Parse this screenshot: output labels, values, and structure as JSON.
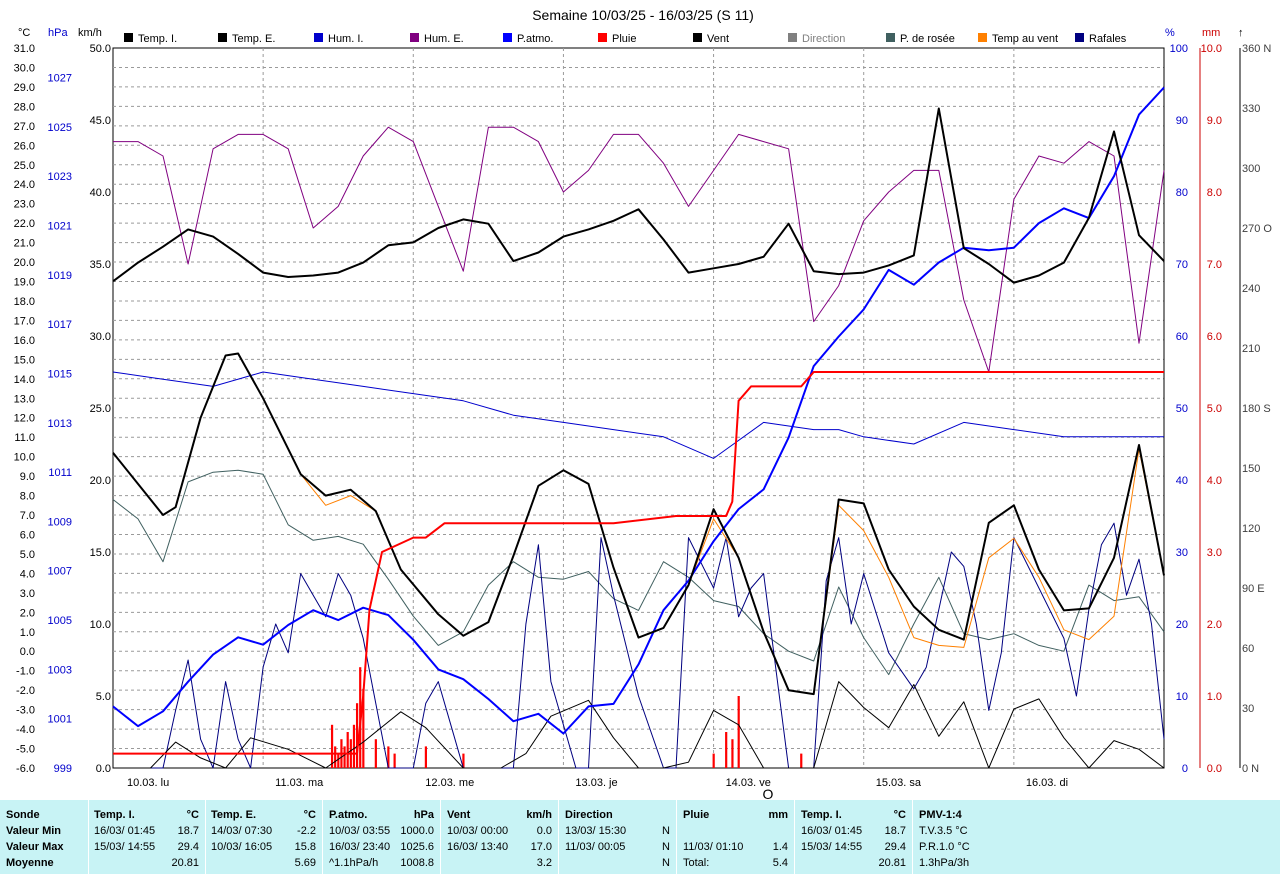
{
  "title": "Semaine 10/03/25 - 16/03/25 (S 11)",
  "axis_units": {
    "temp": "°C",
    "hpa": "hPa",
    "kmh": "km/h",
    "pct": "%",
    "mm": "mm"
  },
  "legend": [
    {
      "label": "Temp. I.",
      "color": "#000000"
    },
    {
      "label": "Temp. E.",
      "color": "#000000"
    },
    {
      "label": "Hum. I.",
      "color": "#0000cc"
    },
    {
      "label": "Hum. E.",
      "color": "#800080"
    },
    {
      "label": "P.atmo.",
      "color": "#0000ff"
    },
    {
      "label": "Pluie",
      "color": "#ff0000"
    },
    {
      "label": "Vent",
      "color": "#000000"
    },
    {
      "label": "Direction",
      "color": "#808080"
    },
    {
      "label": "P. de rosée",
      "color": "#406060"
    },
    {
      "label": "Temp au vent",
      "color": "#ff8000"
    },
    {
      "label": "Rafales",
      "color": "#000080"
    }
  ],
  "bottom_mark": "O",
  "chart_data": {
    "type": "line",
    "title": "Semaine 10/03/25 - 16/03/25 (S 11)",
    "x_days": [
      "10.03. lu",
      "11.03. ma",
      "12.03. me",
      "13.03. je",
      "14.03. ve",
      "15.03. sa",
      "16.03. di"
    ],
    "x_range_hours": [
      0,
      168
    ],
    "axes": {
      "temp_c": {
        "min": -6.0,
        "max": 31.0,
        "ticks": [
          "31.0",
          "30.0",
          "29.0",
          "28.0",
          "27.0",
          "26.0",
          "25.0",
          "24.0",
          "23.0",
          "22.0",
          "21.0",
          "20.0",
          "19.0",
          "18.0",
          "17.0",
          "16.0",
          "15.0",
          "14.0",
          "13.0",
          "12.0",
          "11.0",
          "10.0",
          "9.0",
          "8.0",
          "7.0",
          "6.0",
          "5.0",
          "4.0",
          "3.0",
          "2.0",
          "1.0",
          "0.0",
          "-1.0",
          "-2.0",
          "-3.0",
          "-4.0",
          "-5.0",
          "-6.0"
        ]
      },
      "pressure_hpa": {
        "min": 999,
        "max": 1028.2,
        "ticks": [
          "1027",
          "1025",
          "1023",
          "1021",
          "1019",
          "1017",
          "1015",
          "1013",
          "1011",
          "1009",
          "1007",
          "1005",
          "1003",
          "1001",
          "999"
        ]
      },
      "wind_kmh": {
        "min": 0,
        "max": 50,
        "ticks": [
          "50.0",
          "45.0",
          "40.0",
          "35.0",
          "30.0",
          "25.0",
          "20.0",
          "15.0",
          "10.0",
          "5.0",
          "0.0"
        ]
      },
      "humidity_pct": {
        "min": 0,
        "max": 100,
        "ticks": [
          "100",
          "90",
          "80",
          "70",
          "60",
          "50",
          "40",
          "30",
          "20",
          "10",
          "0"
        ]
      },
      "rain_mm": {
        "min": 0,
        "max": 10,
        "ticks": [
          "10.0",
          "9.0",
          "8.0",
          "7.0",
          "6.0",
          "5.0",
          "4.0",
          "3.0",
          "2.0",
          "1.0",
          "0.0"
        ]
      },
      "direction_deg": {
        "min": 0,
        "max": 360,
        "ticks": [
          "360 N",
          "330",
          "300",
          "270 O",
          "240",
          "210",
          "180 S",
          "150",
          "120",
          "90 E",
          "60",
          "30",
          "0 N"
        ]
      }
    },
    "series": [
      {
        "name": "Temp. I.",
        "axis": "wind_kmh",
        "color": "#000000",
        "width": 2,
        "x": [
          0,
          4,
          8,
          12,
          16,
          20,
          24,
          28,
          32,
          36,
          40,
          44,
          48,
          52,
          56,
          60,
          64,
          68,
          72,
          76,
          80,
          84,
          88,
          92,
          96,
          100,
          104,
          108,
          112,
          116,
          120,
          124,
          128,
          132,
          136,
          140,
          144,
          148,
          152,
          156,
          160,
          164,
          168
        ],
        "y": [
          33.8,
          35.1,
          36.2,
          37.4,
          36.9,
          35.7,
          34.4,
          34.1,
          34.2,
          34.4,
          35.1,
          36.3,
          36.5,
          37.5,
          38.1,
          37.8,
          35.2,
          35.8,
          36.9,
          37.4,
          38.0,
          38.8,
          36.7,
          34.4,
          34.7,
          35.0,
          35.5,
          37.8,
          34.5,
          34.3,
          34.4,
          34.9,
          35.6,
          45.8,
          36.1,
          35.0,
          33.7,
          34.2,
          35.1,
          38.2,
          44.2,
          37.0,
          35.2
        ]
      },
      {
        "name": "Temp. E.",
        "axis": "temp_c",
        "color": "#000000",
        "width": 2,
        "x": [
          0,
          4,
          8,
          10,
          14,
          18,
          20,
          24,
          30,
          34,
          38,
          42,
          46,
          52,
          56,
          60,
          64,
          68,
          72,
          76,
          80,
          84,
          88,
          92,
          96,
          100,
          104,
          108,
          112,
          116,
          120,
          124,
          128,
          132,
          136,
          140,
          144,
          148,
          152,
          156,
          160,
          164,
          168
        ],
        "y": [
          10.2,
          8.6,
          7.0,
          7.4,
          12.0,
          15.2,
          15.3,
          13.0,
          9.1,
          8.0,
          8.3,
          7.2,
          4.2,
          1.9,
          0.8,
          1.5,
          4.9,
          8.5,
          9.3,
          8.6,
          4.3,
          0.7,
          1.2,
          3.4,
          7.3,
          4.8,
          1.0,
          -2.0,
          -2.2,
          7.8,
          7.6,
          4.2,
          2.3,
          1.1,
          0.6,
          6.6,
          7.5,
          4.2,
          2.1,
          2.2,
          4.8,
          10.6,
          3.9
        ]
      },
      {
        "name": "Hum. I.",
        "axis": "humidity_pct",
        "color": "#0000cc",
        "width": 1,
        "x": [
          0,
          8,
          16,
          24,
          32,
          40,
          48,
          56,
          64,
          72,
          80,
          88,
          96,
          104,
          112,
          116,
          120,
          128,
          136,
          144,
          152,
          160,
          168
        ],
        "y": [
          55,
          54,
          53,
          55,
          54,
          53,
          52,
          51,
          49,
          48,
          47,
          46,
          43,
          48,
          47,
          47,
          46,
          45,
          48,
          47,
          46,
          46,
          46
        ]
      },
      {
        "name": "Hum. E.",
        "axis": "humidity_pct",
        "color": "#800080",
        "width": 1,
        "x": [
          0,
          4,
          8,
          12,
          16,
          20,
          24,
          28,
          32,
          36,
          40,
          44,
          48,
          52,
          56,
          60,
          64,
          68,
          72,
          76,
          80,
          84,
          88,
          92,
          96,
          100,
          104,
          108,
          112,
          116,
          120,
          124,
          128,
          132,
          136,
          140,
          144,
          148,
          152,
          156,
          160,
          164,
          168
        ],
        "y": [
          87,
          87,
          85,
          70,
          86,
          88,
          88,
          86,
          75,
          78,
          85,
          89,
          87,
          78,
          69,
          89,
          89,
          87,
          80,
          83,
          88,
          88,
          84,
          78,
          83,
          88,
          87,
          86,
          62,
          67,
          76,
          80,
          83,
          83,
          65,
          55,
          79,
          85,
          84,
          87,
          85,
          59,
          83
        ]
      },
      {
        "name": "P.atmo.",
        "axis": "pressure_hpa",
        "color": "#0000ff",
        "width": 2,
        "x": [
          0,
          4,
          8,
          12,
          16,
          20,
          24,
          28,
          32,
          36,
          40,
          44,
          48,
          52,
          56,
          60,
          64,
          68,
          72,
          76,
          80,
          84,
          88,
          92,
          96,
          100,
          104,
          108,
          112,
          116,
          120,
          124,
          128,
          132,
          136,
          140,
          144,
          148,
          152,
          156,
          160,
          164,
          168
        ],
        "y": [
          1001.5,
          1000.7,
          1001.3,
          1002.5,
          1003.6,
          1004.3,
          1004.0,
          1004.8,
          1005.4,
          1005.0,
          1005.5,
          1005.2,
          1004.2,
          1003.0,
          1002.6,
          1001.8,
          1000.9,
          1001.2,
          1000.4,
          1001.5,
          1001.6,
          1003.2,
          1005.4,
          1006.6,
          1008.2,
          1009.5,
          1010.3,
          1012.4,
          1015.3,
          1016.5,
          1017.6,
          1019.2,
          1018.6,
          1019.5,
          1020.1,
          1020.0,
          1020.1,
          1021.1,
          1021.7,
          1021.3,
          1023.0,
          1025.5,
          1026.6
        ]
      },
      {
        "name": "Pluie",
        "axis": "rain_mm",
        "color": "#ff0000",
        "width": 2,
        "x": [
          0,
          39,
          40,
          41,
          43,
          48,
          50,
          53,
          60,
          67,
          70,
          80,
          90,
          98,
          99,
          100,
          102,
          110,
          112,
          136,
          168
        ],
        "y": [
          0.2,
          0.2,
          1.0,
          2.2,
          3.0,
          3.2,
          3.2,
          3.4,
          3.4,
          3.4,
          3.4,
          3.4,
          3.5,
          3.5,
          3.7,
          5.1,
          5.3,
          5.3,
          5.5,
          5.5,
          5.5
        ]
      },
      {
        "name": "Vent",
        "axis": "wind_kmh",
        "color": "#000000",
        "width": 1,
        "x": [
          0,
          6,
          10,
          14,
          18,
          22,
          28,
          34,
          40,
          46,
          50,
          56,
          62,
          66,
          70,
          76,
          80,
          84,
          88,
          92,
          96,
          100,
          104,
          108,
          112,
          116,
          120,
          124,
          128,
          132,
          136,
          140,
          144,
          148,
          152,
          156,
          160,
          164,
          168
        ],
        "y": [
          0.0,
          0.0,
          1.8,
          0.7,
          0.0,
          2.1,
          1.3,
          0.0,
          1.8,
          3.9,
          2.8,
          0.0,
          0.0,
          1.0,
          3.6,
          4.7,
          2.1,
          0.0,
          0.0,
          0.4,
          4.0,
          3.0,
          0.0,
          0.0,
          0.0,
          6.0,
          4.2,
          2.8,
          5.8,
          2.2,
          4.6,
          0.0,
          4.1,
          4.8,
          2.1,
          0.0,
          1.9,
          1.3,
          0.0
        ]
      },
      {
        "name": "P. de rosée",
        "axis": "temp_c",
        "color": "#406060",
        "width": 1,
        "x": [
          0,
          4,
          8,
          12,
          16,
          20,
          24,
          28,
          32,
          36,
          40,
          44,
          48,
          52,
          56,
          60,
          64,
          68,
          72,
          76,
          80,
          84,
          88,
          92,
          96,
          100,
          104,
          108,
          112,
          116,
          120,
          124,
          128,
          132,
          136,
          140,
          144,
          148,
          152,
          156,
          160,
          164,
          168
        ],
        "y": [
          7.8,
          6.8,
          4.6,
          8.7,
          9.2,
          9.3,
          9.1,
          6.5,
          5.7,
          5.9,
          5.5,
          3.7,
          1.8,
          0.3,
          1.0,
          3.4,
          4.6,
          3.8,
          3.7,
          4.1,
          2.7,
          2.1,
          4.6,
          3.8,
          2.6,
          2.3,
          0.9,
          0.0,
          -0.5,
          3.3,
          0.7,
          -1.2,
          1.4,
          3.8,
          0.9,
          0.6,
          0.9,
          0.3,
          0.0,
          3.4,
          2.6,
          2.8,
          1.0
        ]
      },
      {
        "name": "Temp au vent",
        "axis": "temp_c",
        "color": "#ff8000",
        "width": 1,
        "x": [
          0,
          4,
          8,
          10,
          14,
          18,
          20,
          24,
          30,
          34,
          38,
          42,
          46,
          52,
          56,
          60,
          64,
          68,
          72,
          76,
          80,
          84,
          88,
          92,
          96,
          100,
          104,
          108,
          112,
          116,
          120,
          124,
          128,
          132,
          136,
          140,
          144,
          148,
          152,
          156,
          160,
          164,
          168
        ],
        "y": [
          10.2,
          8.6,
          7.0,
          7.4,
          12.0,
          15.2,
          15.3,
          13.0,
          9.1,
          7.5,
          8.0,
          7.2,
          4.2,
          1.9,
          0.8,
          1.5,
          4.9,
          8.5,
          9.3,
          8.6,
          4.3,
          0.7,
          1.2,
          3.4,
          6.8,
          4.8,
          1.0,
          -2.0,
          -2.2,
          7.5,
          6.2,
          3.8,
          0.7,
          0.3,
          0.2,
          4.8,
          5.8,
          3.8,
          1.1,
          0.6,
          1.8,
          10.4,
          3.9
        ]
      },
      {
        "name": "Rafales",
        "axis": "wind_kmh",
        "color": "#000080",
        "width": 1,
        "x": [
          0,
          4,
          8,
          10,
          12,
          14,
          16,
          18,
          20,
          22,
          24,
          26,
          28,
          30,
          32,
          34,
          36,
          38,
          40,
          44,
          48,
          50,
          52,
          54,
          56,
          60,
          64,
          66,
          68,
          70,
          74,
          76,
          78,
          80,
          84,
          88,
          90,
          92,
          96,
          98,
          100,
          102,
          104,
          108,
          112,
          114,
          116,
          118,
          120,
          124,
          128,
          130,
          132,
          134,
          136,
          138,
          140,
          142,
          144,
          148,
          152,
          154,
          156,
          158,
          160,
          162,
          164,
          166,
          168
        ],
        "y": [
          0.0,
          0.0,
          0.0,
          4.0,
          7.5,
          2.0,
          0.0,
          6.0,
          2.0,
          0.0,
          7.0,
          10.0,
          8.0,
          13.5,
          12.0,
          10.5,
          13.5,
          12.0,
          9.0,
          0.0,
          0.0,
          4.5,
          6.0,
          3.0,
          0.0,
          0.0,
          0.0,
          10.0,
          15.5,
          6.0,
          0.0,
          0.0,
          16.0,
          12.0,
          5.0,
          0.0,
          0.0,
          16.0,
          12.5,
          16.0,
          10.5,
          12.5,
          13.5,
          0.0,
          0.0,
          13.0,
          16.0,
          10.0,
          13.5,
          8.0,
          5.5,
          7.0,
          11.0,
          15.0,
          14.0,
          10.0,
          4.0,
          8.0,
          16.0,
          12.5,
          9.0,
          5.0,
          11.0,
          15.5,
          17.0,
          12.0,
          14.5,
          10.0,
          2.0
        ]
      }
    ],
    "rain_bars": {
      "axis": "rain_mm",
      "color": "#ff0000",
      "x": [
        35,
        35.5,
        36,
        36.5,
        37,
        37.5,
        38,
        38.5,
        39,
        39.5,
        40,
        42,
        44,
        45,
        50,
        56,
        96,
        98,
        99,
        100,
        110
      ],
      "y": [
        0.6,
        0.3,
        0.2,
        0.4,
        0.3,
        0.5,
        0.4,
        0.6,
        0.9,
        1.4,
        1.1,
        0.4,
        0.3,
        0.2,
        0.3,
        0.2,
        0.2,
        0.5,
        0.4,
        1.0,
        0.2
      ]
    }
  },
  "stats": {
    "row_labels": [
      "Sonde",
      "Valeur Min",
      "Valeur Max",
      "Moyenne"
    ],
    "blocks": [
      {
        "head": "Temp. I.",
        "unit": "°C",
        "min_date": "16/03/ 01:45",
        "min": "18.7",
        "max_date": "15/03/ 14:55",
        "max": "29.4",
        "avg_date": "",
        "avg": "20.81"
      },
      {
        "head": "Temp. E.",
        "unit": "°C",
        "min_date": "14/03/ 07:30",
        "min": "-2.2",
        "max_date": "10/03/ 16:05",
        "max": "15.8",
        "avg_date": "",
        "avg": "5.69"
      },
      {
        "head": "P.atmo.",
        "unit": "hPa",
        "min_date": "10/03/ 03:55",
        "min": "1000.0",
        "max_date": "16/03/ 23:40",
        "max": "1025.6",
        "avg_date": "^1.1hPa/h",
        "avg": "1008.8"
      },
      {
        "head": "Vent",
        "unit": "km/h",
        "min_date": "10/03/ 00:00",
        "min": "0.0",
        "max_date": "16/03/ 13:40",
        "max": "17.0",
        "avg_date": "",
        "avg": "3.2"
      },
      {
        "head": "Direction",
        "unit": "",
        "min_date": "13/03/ 15:30",
        "min": "N",
        "max_date": "11/03/ 00:05",
        "max": "N",
        "avg_date": "",
        "avg": "N"
      },
      {
        "head": "Pluie",
        "unit": "mm",
        "min_date": "",
        "min": "",
        "max_date": "11/03/ 01:10",
        "max": "1.4",
        "avg_date": "Total:",
        "avg": "5.4"
      },
      {
        "head": "Temp. I.",
        "unit": "°C",
        "min_date": "16/03/ 01:45",
        "min": "18.7",
        "max_date": "15/03/ 14:55",
        "max": "29.4",
        "avg_date": "",
        "avg": "20.81"
      }
    ],
    "pmv": {
      "head": "PMV-1:4",
      "line1": "T.V.3.5 °C",
      "line2": "P.R.1.0 °C",
      "line3": "1.3hPa/3h"
    }
  }
}
